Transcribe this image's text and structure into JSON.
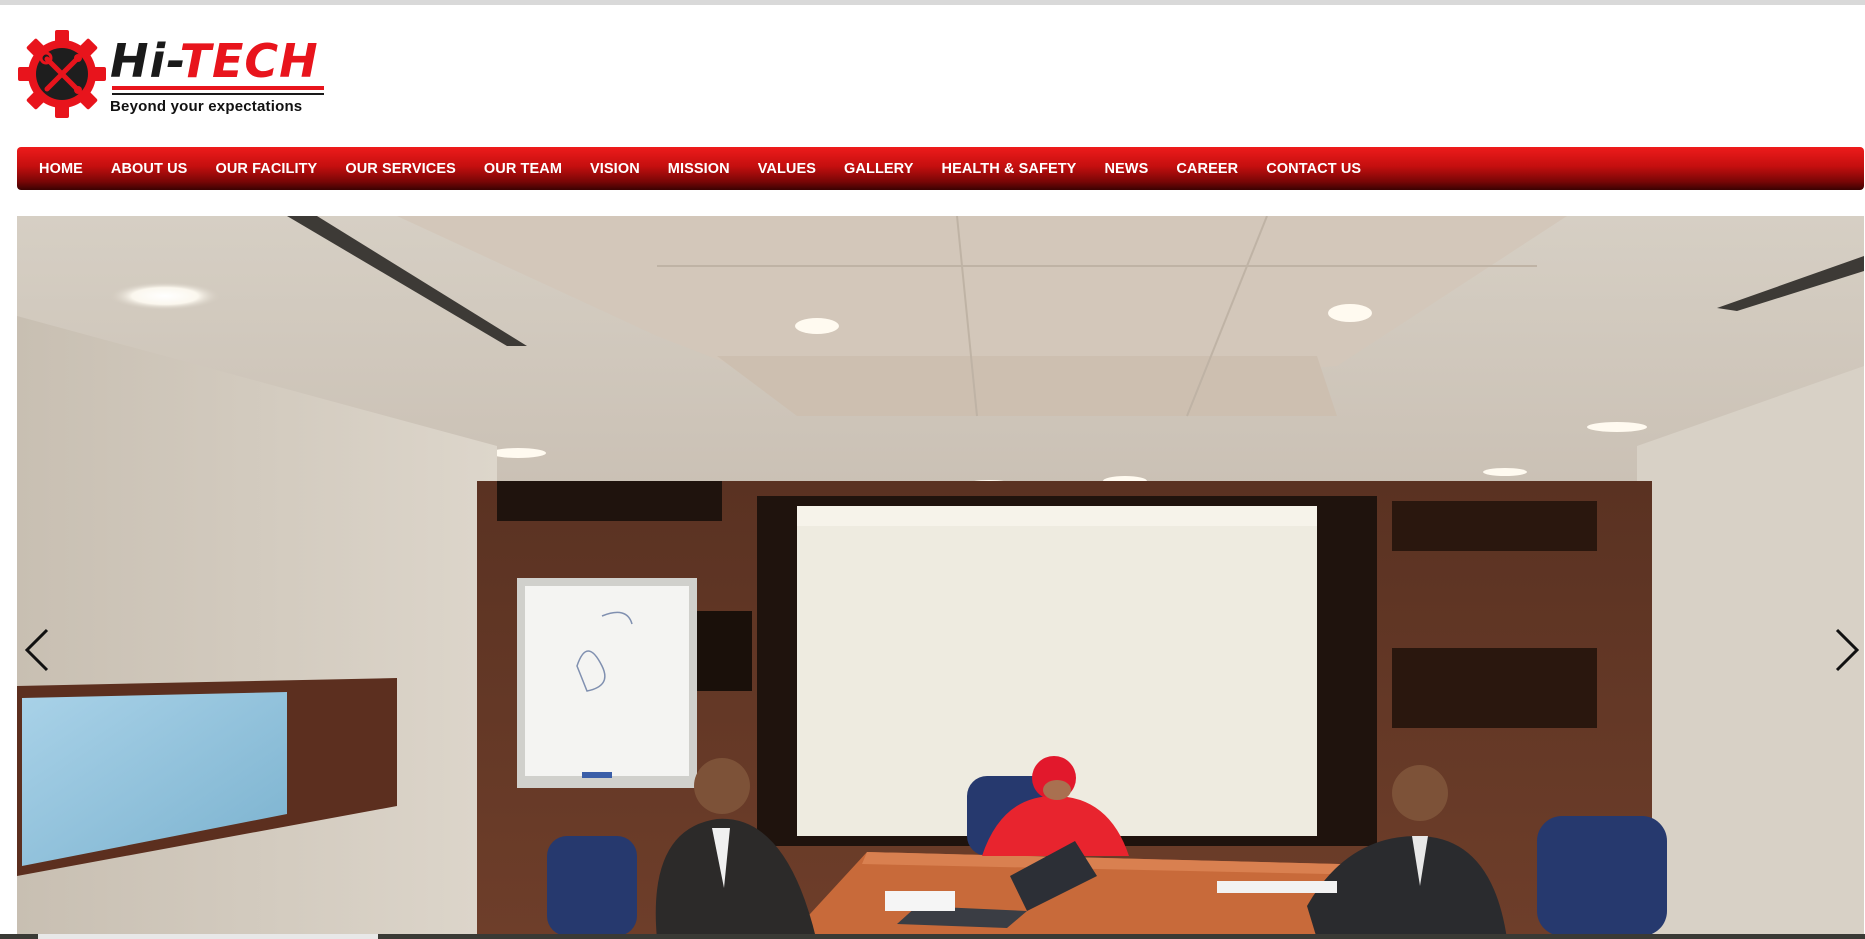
{
  "brand": {
    "title_part1": "Hi-",
    "title_part2": "TECH",
    "tagline": "Beyond your expectations",
    "colors": {
      "accent": "#e8141c",
      "dark": "#1a1a1a"
    }
  },
  "nav": {
    "items": [
      "HOME",
      "ABOUT US",
      "OUR FACILITY",
      "OUR SERVICES",
      "OUR TEAM",
      "VISION",
      "MISSION",
      "VALUES",
      "GALLERY",
      "HEALTH & SAFETY",
      "NEWS",
      "CAREER",
      "CONTACT US"
    ],
    "colors": {
      "bar_top": "#ee1b1b",
      "bar_bottom": "#3a0202",
      "text": "#ffffff"
    }
  },
  "slider": {
    "prev_icon": "chevron-left-icon",
    "next_icon": "chevron-right-icon",
    "photo": "conference-room-meeting"
  }
}
